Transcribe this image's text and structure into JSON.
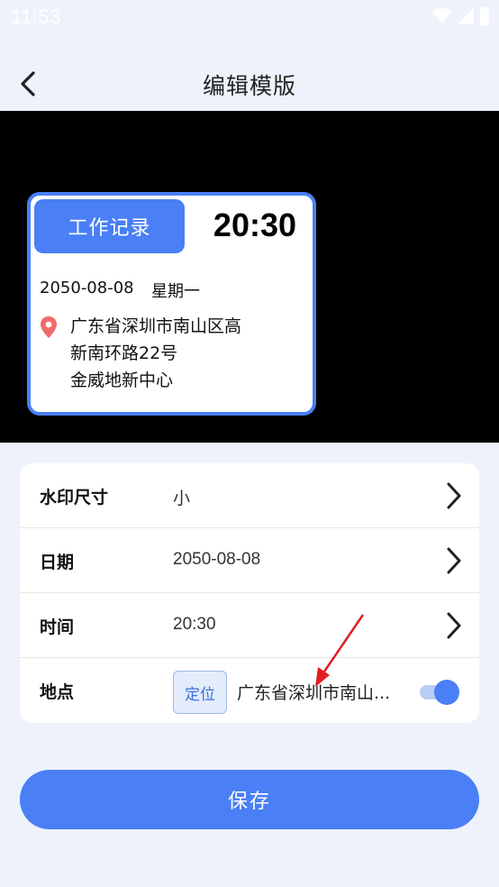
{
  "status_bar": {
    "time": "11:53"
  },
  "header": {
    "title": "编辑模版",
    "back_icon": "chevron-left-icon"
  },
  "watermark": {
    "tag": "工作记录",
    "time": "20:30",
    "date": "2050-08-08",
    "weekday": "星期一",
    "address_lines": [
      "广东省深圳市南山区高",
      "新南环路22号",
      "金威地新中心"
    ],
    "accent_color": "#4a7ff5"
  },
  "settings": {
    "rows": [
      {
        "label": "水印尺寸",
        "value": "小"
      },
      {
        "label": "日期",
        "value": "2050-08-08"
      },
      {
        "label": "时间",
        "value": "20:30"
      },
      {
        "label": "地点",
        "button": "定位",
        "value": "广东省深圳市南山...",
        "toggle_on": true
      }
    ]
  },
  "save_button": "保存"
}
